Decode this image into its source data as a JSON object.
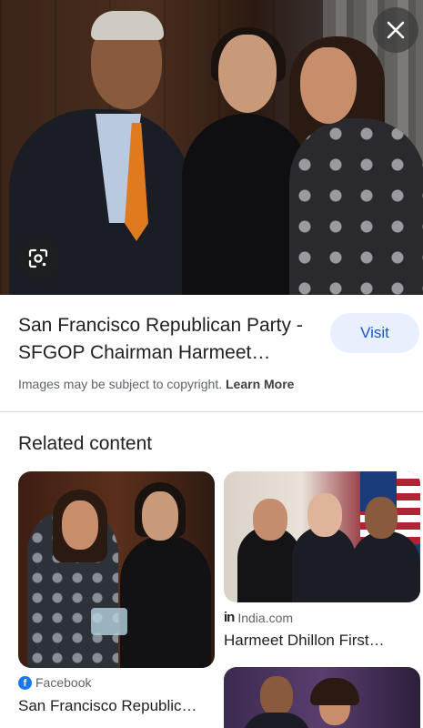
{
  "hero": {
    "close_icon": "close-icon",
    "lens_icon": "google-lens-icon"
  },
  "result": {
    "title": "San Francisco Republican Party - SFGOP Chairman Harmeet…",
    "visit_label": "Visit",
    "copyright_text": "Images may be subject to copyright.",
    "learn_more_label": "Learn More"
  },
  "related": {
    "heading": "Related content",
    "cards": [
      {
        "source": "Facebook",
        "source_icon": "facebook-icon",
        "title": "San Francisco Republic…"
      },
      {
        "source": "India.com",
        "source_icon": "india-com-icon",
        "title": "Harmeet Dhillon First…"
      },
      {
        "source": "",
        "title": ""
      }
    ]
  },
  "colors": {
    "visit_bg": "#e8f0fe",
    "visit_text": "#1a56c8",
    "facebook_blue": "#1877f2"
  }
}
